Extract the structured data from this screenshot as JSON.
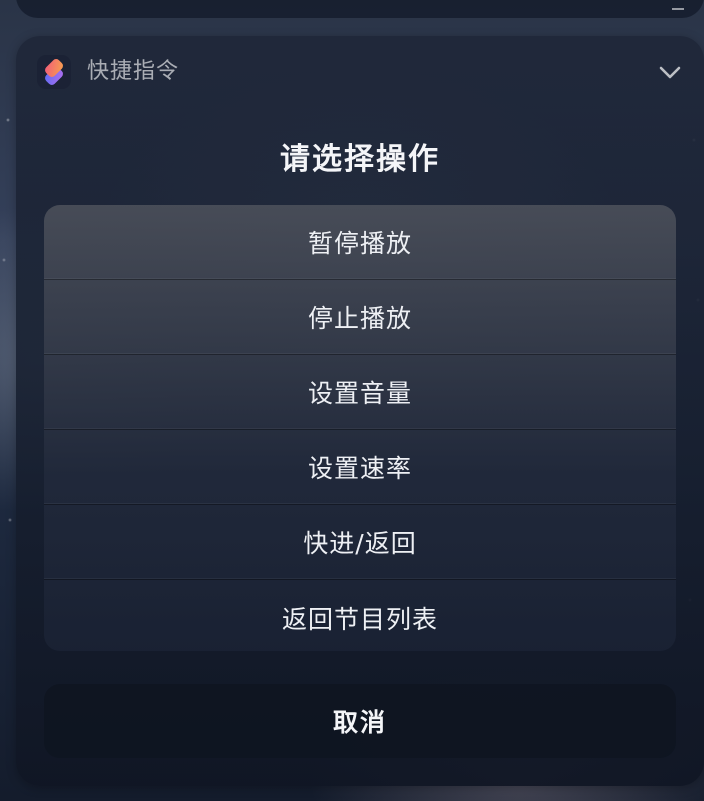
{
  "header": {
    "app_name": "快捷指令",
    "app_icon": "shortcuts-icon",
    "collapse_icon": "chevron-down-icon"
  },
  "sheet": {
    "title": "请选择操作",
    "actions": [
      {
        "label": "暂停播放"
      },
      {
        "label": "停止播放"
      },
      {
        "label": "设置音量"
      },
      {
        "label": "设置速率"
      },
      {
        "label": "快进/返回"
      },
      {
        "label": "返回节目列表"
      }
    ],
    "cancel_label": "取消"
  },
  "colors": {
    "widget_bg": "#1e2638",
    "text_primary": "#f4f5f8",
    "text_secondary": "#9aa0ab"
  }
}
